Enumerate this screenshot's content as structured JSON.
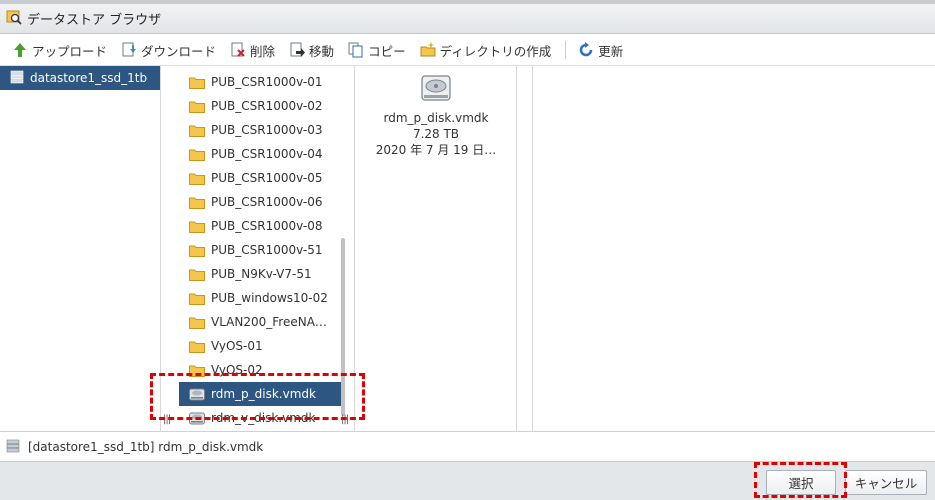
{
  "window": {
    "title": "データストア ブラウザ"
  },
  "toolbar": {
    "upload": "アップロード",
    "download": "ダウンロード",
    "delete": "削除",
    "move": "移動",
    "copy": "コピー",
    "mkdir": "ディレクトリの作成",
    "refresh": "更新"
  },
  "datastores": [
    {
      "label": "datastore1_ssd_1tb",
      "selected": true
    }
  ],
  "folders": [
    {
      "label": "PUB_CSR1000v-01",
      "type": "folder"
    },
    {
      "label": "PUB_CSR1000v-02",
      "type": "folder"
    },
    {
      "label": "PUB_CSR1000v-03",
      "type": "folder"
    },
    {
      "label": "PUB_CSR1000v-04",
      "type": "folder"
    },
    {
      "label": "PUB_CSR1000v-05",
      "type": "folder"
    },
    {
      "label": "PUB_CSR1000v-06",
      "type": "folder"
    },
    {
      "label": "PUB_CSR1000v-08",
      "type": "folder"
    },
    {
      "label": "PUB_CSR1000v-51",
      "type": "folder"
    },
    {
      "label": "PUB_N9Kv-V7-51",
      "type": "folder"
    },
    {
      "label": "PUB_windows10-02",
      "type": "folder"
    },
    {
      "label": "VLAN200_FreeNA…",
      "type": "folder"
    },
    {
      "label": "VyOS-01",
      "type": "folder"
    },
    {
      "label": "VyOS-02",
      "type": "folder"
    },
    {
      "label": "rdm_p_disk.vmdk",
      "type": "disk",
      "selected": true
    },
    {
      "label": "rdm_v_disk.vmdk",
      "type": "disk"
    }
  ],
  "details": {
    "name": "rdm_p_disk.vmdk",
    "size": "7.28 TB",
    "date": "2020 年 7 月 19 日…"
  },
  "status": {
    "path": "[datastore1_ssd_1tb] rdm_p_disk.vmdk"
  },
  "buttons": {
    "ok": "選択",
    "cancel": "キャンセル"
  },
  "colors": {
    "selection": "#2d5683",
    "highlight_dash": "#e00000",
    "folder": "#f4c64c"
  }
}
